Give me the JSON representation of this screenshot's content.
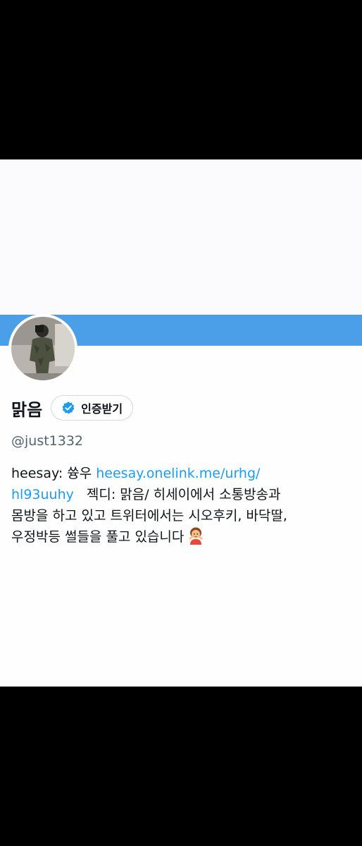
{
  "profile": {
    "display_name": "맑음",
    "verify_button_label": "인증받기",
    "handle": "@just1332",
    "bio": {
      "prefix": "heesay: 쓩우 ",
      "link_part1": "heesay.onelink.me/urhg/",
      "link_part2": "hl93uuhy",
      "after_link": "젝디: 맑음/  히세이에서 소통방송과",
      "line3": "몸방을 하고 있고 트위터에서는 시오후키, 바닥딸,",
      "line4": "우정박등 썰들을 풀고 있습니다"
    }
  },
  "colors": {
    "banner": "#4a9fe8",
    "link": "#1d9bf0",
    "verified_badge": "#1d9bf0",
    "handle_text": "#536471"
  },
  "icons": {
    "verified": "verified-badge-icon",
    "emoji": "person-gesturing-emoji-icon"
  }
}
